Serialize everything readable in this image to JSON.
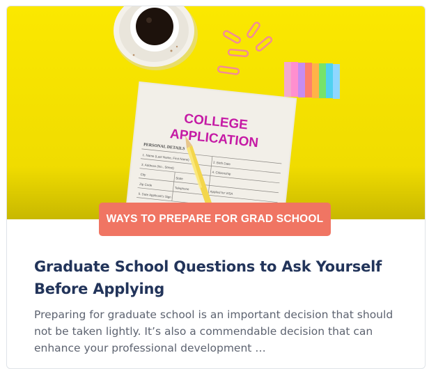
{
  "article": {
    "category_label": "WAYS TO PREPARE FOR GRAD SCHOOL",
    "title": "Graduate School Questions to Ask Yourself Before Applying",
    "excerpt": "Preparing for graduate school is an important decision that should not be taken lightly. It’s also a commendable decision that can enhance your professional development …"
  },
  "image": {
    "heading_line1": "COLLEGE",
    "heading_line2": "APPLICATION",
    "form_section": "PERSONAL DETAILS",
    "form_fields": [
      "1. Name (Last Name, First Name)",
      "2. Birth Date",
      "3. Address (No., Street)",
      "4. Citizenship",
      "City",
      "State",
      "Zip Code",
      "Telephone",
      "Applied for VISA",
      "5. Date Applicant's Sign"
    ]
  },
  "colors": {
    "background_yellow": "#f7e300",
    "pill": "#f07563",
    "title": "#22345a",
    "excerpt": "#5d6370"
  }
}
